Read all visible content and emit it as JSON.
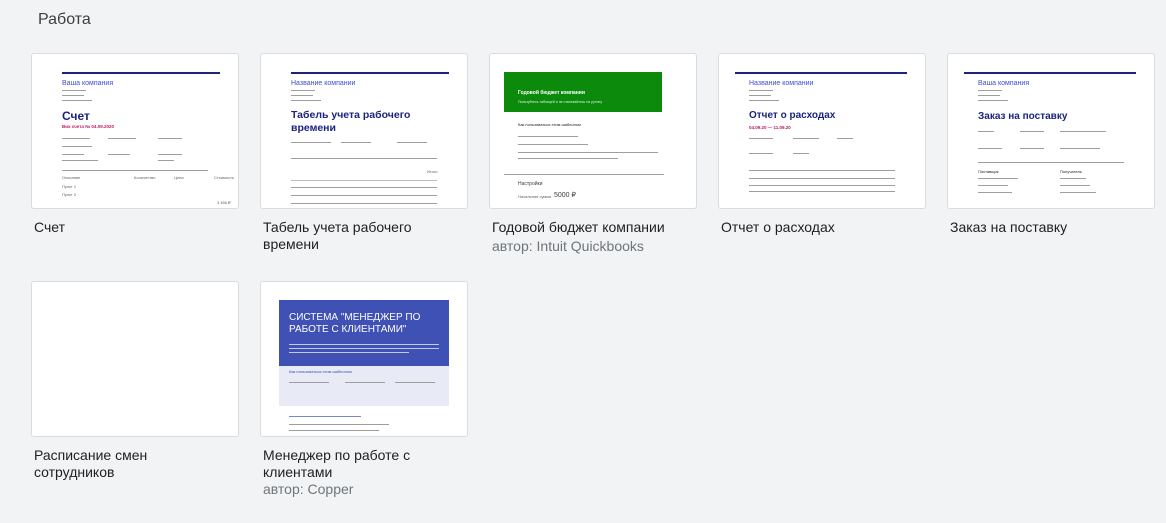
{
  "section": {
    "title": "Работа"
  },
  "templates": [
    {
      "name": "Счет",
      "author": ""
    },
    {
      "name": "Табель учета рабочего времени",
      "author": ""
    },
    {
      "name": "Годовой бюджет компании",
      "author": "автор: Intuit Quickbooks"
    },
    {
      "name": "Отчет о расходах",
      "author": ""
    },
    {
      "name": "Заказ на поставку",
      "author": ""
    },
    {
      "name": "Расписание смен сотрудников",
      "author": ""
    },
    {
      "name": "Менеджер по работе с клиентами",
      "author": "автор: Copper"
    }
  ],
  "thumbnails": {
    "invoice": {
      "company": "Ваша компания",
      "title": "Счет",
      "subtitle": "Вих счета № 04.09.2020",
      "col_desc": "Описание",
      "col_qty": "Количество",
      "col_price": "Цена",
      "col_cost": "Стоимость",
      "item1": "Пункт 1",
      "item2": "Пункт 2",
      "total": "3 456 ₽"
    },
    "timesheet": {
      "company": "Название компании",
      "title": "Табель учета рабочего времени",
      "col_total": "Итого"
    },
    "budget": {
      "banner_title": "Годовой бюджет компании",
      "banner_sub": "Пользуйтесь таблицей и не отвлекайтесь на рутину",
      "howto": "Как пользоваться этим шаблоном",
      "settings": "Настройки",
      "total_label": "Начальная сумма",
      "total_value": "5000 ₽"
    },
    "expenses": {
      "company": "Название компании",
      "title": "Отчет о расходах",
      "dates": "04.09.20 — 11.09.20"
    },
    "order": {
      "company": "Ваша компания",
      "title": "Заказ на поставку",
      "supplier": "Поставщик",
      "recipient": "Получатель"
    },
    "crm": {
      "title": "СИСТЕМА \"МЕНЕДЖЕР ПО РАБОТЕ С КЛИЕНТАМИ\"",
      "howto": "Как пользоваться этим шаблоном"
    }
  },
  "colors": {
    "page_bg": "#f1f3f4",
    "navy": "#1a237e",
    "green_banner": "#0b8a0b",
    "crm_banner": "#3f51b5",
    "author_text": "#70757a"
  }
}
